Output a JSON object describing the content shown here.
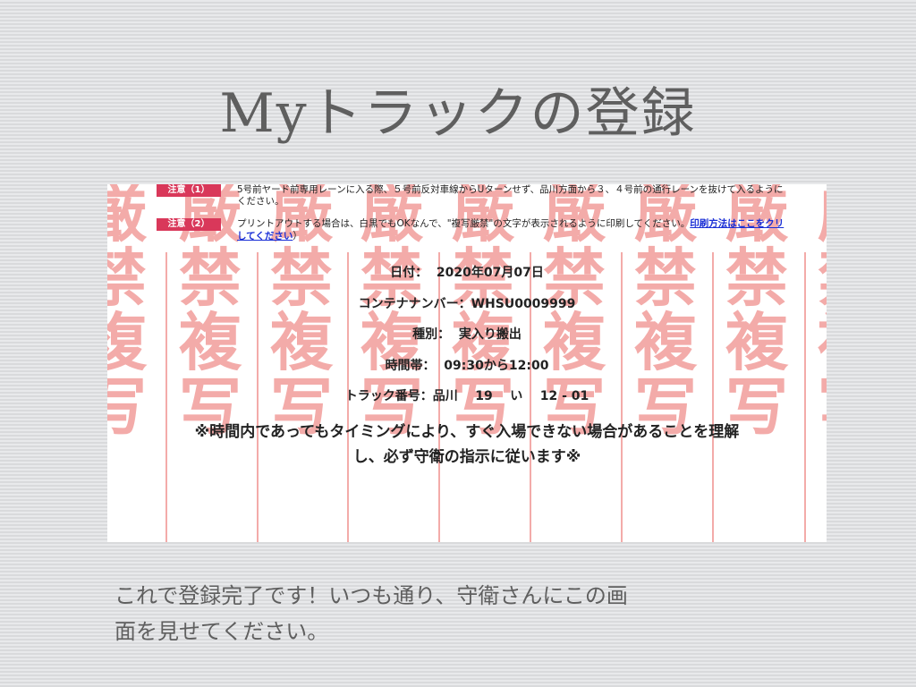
{
  "slide": {
    "title": "Myトラックの登録",
    "caption_lines": [
      "これで登録完了です！いつも通り、守衛さんにこの画",
      "面を見せてください。"
    ]
  },
  "screenshot": {
    "watermark": {
      "chars": [
        "写",
        "厳",
        "禁",
        "複",
        "写"
      ],
      "color": "#f3aba9"
    },
    "notes": [
      {
        "badge": "注意（1）",
        "lines": [
          "5号前ヤード前専用レーンに入る際、５号前反対車線からUターンせず、品川方面から３、４号前の通行レーンを抜けて入るように",
          "ください。"
        ]
      },
      {
        "badge": "注意（2）",
        "text": "プリントアウトする場合は、白黒でもOKなんで、\"複写厳禁\"の文字が表示されるように印刷してください。",
        "link_line1": "印刷方法はここをクリ",
        "link_line2": "してください",
        "link_suffix": "）"
      }
    ],
    "info": {
      "date": "日付：  2020年07月07日",
      "container": "コンテナナンバー：WHSU0009999",
      "type": "種別：  実入り搬出",
      "timeslot": "時間帯：  09:30から12:00",
      "truck": "トラック番号：品川    19    い    12 - 01"
    },
    "warning_lines": [
      "※時間内であってもタイミングにより、すぐ入場できない場合があることを理解",
      "し、必ず守衛の指示に従います※"
    ],
    "badge_color": "#d9385a",
    "link_color": "#1a2fd6"
  }
}
